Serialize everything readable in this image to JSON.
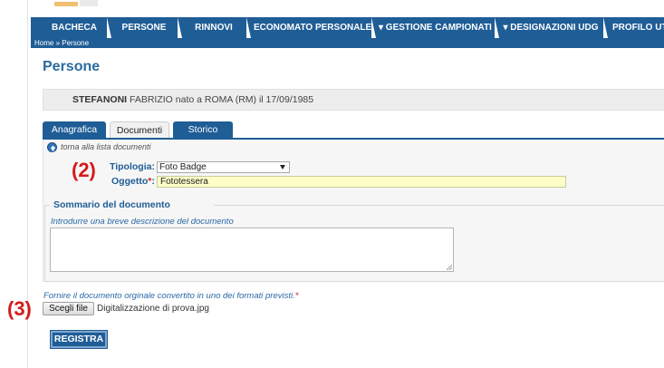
{
  "nav": {
    "tabs": [
      {
        "label": "BACHECA"
      },
      {
        "label": "PERSONE"
      },
      {
        "label": "RINNOVI"
      },
      {
        "label": "ECONOMATO PERSONALE"
      },
      {
        "label": "▾ GESTIONE CAMPIONATI"
      },
      {
        "label": "▾ DESIGNAZIONI UDG"
      },
      {
        "label": "PROFILO UT"
      }
    ]
  },
  "breadcrumb": {
    "home": "Home",
    "separator": " » ",
    "current": "Persone"
  },
  "page": {
    "title": "Persone"
  },
  "person": {
    "surname": "STEFANONI",
    "details": " FABRIZIO nato a ROMA (RM) il 17/09/1985"
  },
  "tabs": [
    {
      "label": "Anagrafica"
    },
    {
      "label": "Documenti"
    },
    {
      "label": "Storico"
    }
  ],
  "back_link": "torna alla lista documenti",
  "annotations": {
    "step2": "(2)",
    "step3": "(3)"
  },
  "form": {
    "tipologia_label": "Tipologia:",
    "tipologia_value": "Foto Badge",
    "oggetto_label": "Oggetto",
    "oggetto_required": "*",
    "oggetto_colon": ":",
    "oggetto_value": "Fototessera",
    "summary_legend": "Sommario del documento",
    "summary_hint": "Introdurre una breve descrizione del documento",
    "file_hint": "Fornire il documento orginale convertito in uno dei formati previsti.",
    "file_required": "*",
    "file_button": "Scegli file",
    "file_name": "Digitalizzazione di prova.jpg",
    "submit": "REGISTRA"
  },
  "colors": {
    "primary": "#1f5d96",
    "title": "#2c6aa0",
    "annotation": "#d41a1a",
    "highlight_input": "#fdfdc7"
  }
}
